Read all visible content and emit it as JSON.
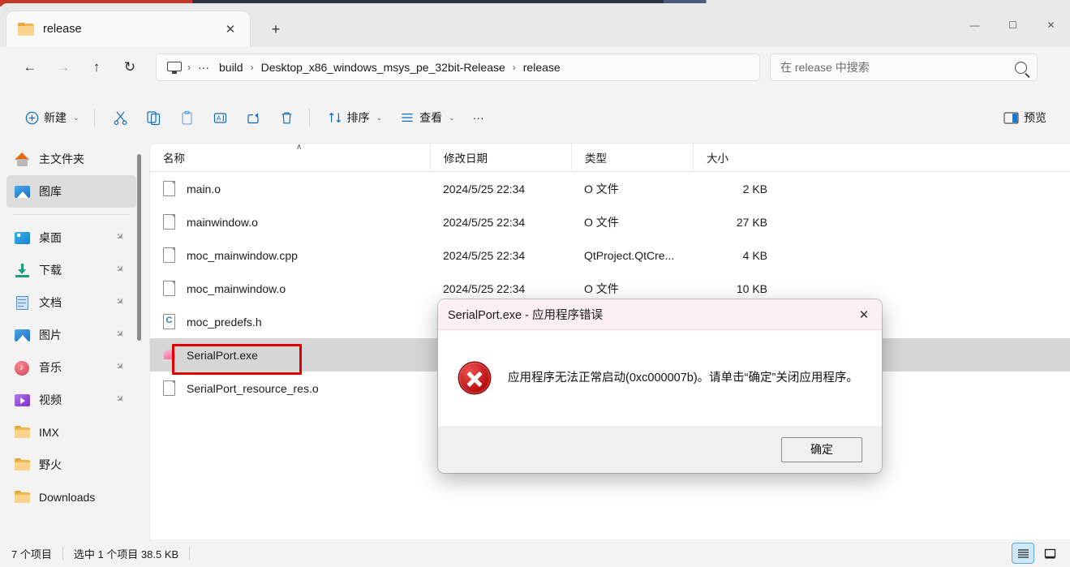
{
  "window": {
    "tab_title": "release",
    "tab_icon": "folder-icon",
    "close_tab_label": "✕",
    "new_tab_label": "+",
    "minimize_label": "—",
    "maximize_label": "☐",
    "close_label": "✕"
  },
  "nav": {
    "back_label": "←",
    "forward_label": "→",
    "up_label": "↑",
    "refresh_label": "↻",
    "breadcrumb": [
      "build",
      "Desktop_x86_windows_msys_pe_32bit-Release",
      "release"
    ],
    "breadcrumb_overflow": "···",
    "separator": "›"
  },
  "search": {
    "placeholder": "在 release 中搜索",
    "value": "",
    "icon": "search-icon"
  },
  "toolbar": {
    "new_label": "新建",
    "cut_label": "",
    "copy_label": "",
    "paste_label": "",
    "rename_label": "",
    "share_label": "",
    "delete_label": "",
    "sort_label": "排序",
    "view_label": "查看",
    "more_label": "···",
    "preview_label": "预览",
    "chevron": "⌄"
  },
  "sidebar": {
    "items": [
      {
        "label": "主文件夹",
        "icon": "home-icon",
        "selected": false,
        "pinned": false
      },
      {
        "label": "图库",
        "icon": "gallery-icon",
        "selected": true,
        "pinned": false
      },
      {
        "label": "桌面",
        "icon": "desktop-icon",
        "selected": false,
        "pinned": true
      },
      {
        "label": "下载",
        "icon": "download-icon",
        "selected": false,
        "pinned": true
      },
      {
        "label": "文档",
        "icon": "document-icon",
        "selected": false,
        "pinned": true
      },
      {
        "label": "图片",
        "icon": "pictures-icon",
        "selected": false,
        "pinned": true
      },
      {
        "label": "音乐",
        "icon": "music-icon",
        "selected": false,
        "pinned": true
      },
      {
        "label": "视频",
        "icon": "video-icon",
        "selected": false,
        "pinned": true
      },
      {
        "label": "IMX",
        "icon": "folder-icon",
        "selected": false,
        "pinned": false
      },
      {
        "label": "野火",
        "icon": "folder-icon",
        "selected": false,
        "pinned": false
      },
      {
        "label": "Downloads",
        "icon": "folder-icon",
        "selected": false,
        "pinned": false
      }
    ],
    "pin_glyph": "✈"
  },
  "filelist": {
    "columns": [
      {
        "label": "名称",
        "sorted": "asc"
      },
      {
        "label": "修改日期",
        "sorted": ""
      },
      {
        "label": "类型",
        "sorted": ""
      },
      {
        "label": "大小",
        "sorted": ""
      }
    ],
    "sort_arrow": "∧",
    "rows": [
      {
        "name": "main.o",
        "icon": "file-icon",
        "date": "2024/5/25 22:34",
        "type": "O 文件",
        "size": "2 KB",
        "selected": false
      },
      {
        "name": "mainwindow.o",
        "icon": "file-icon",
        "date": "2024/5/25 22:34",
        "type": "O 文件",
        "size": "27 KB",
        "selected": false
      },
      {
        "name": "moc_mainwindow.cpp",
        "icon": "file-icon",
        "date": "2024/5/25 22:34",
        "type": "QtProject.QtCre...",
        "size": "4 KB",
        "selected": false
      },
      {
        "name": "moc_mainwindow.o",
        "icon": "file-icon",
        "date": "2024/5/25 22:34",
        "type": "O 文件",
        "size": "10 KB",
        "selected": false
      },
      {
        "name": "moc_predefs.h",
        "icon": "c-header-icon",
        "date": "",
        "type": "",
        "size": "",
        "selected": false
      },
      {
        "name": "SerialPort.exe",
        "icon": "exe-icon",
        "date": "",
        "type": "",
        "size": "",
        "selected": true
      },
      {
        "name": "SerialPort_resource_res.o",
        "icon": "file-icon",
        "date": "",
        "type": "",
        "size": "",
        "selected": false
      }
    ]
  },
  "status": {
    "item_count": "7 个项目",
    "selection": "选中 1 个项目  38.5 KB",
    "view_details_label": "",
    "view_tiles_label": ""
  },
  "dialog": {
    "title": "SerialPort.exe - 应用程序错误",
    "close_label": "✕",
    "icon": "error-icon",
    "message": "应用程序无法正常启动(0xc000007b)。请单击“确定”关闭应用程序。",
    "ok_label": "确定"
  },
  "colors": {
    "accent": "#0f6cbd",
    "error_red": "#c00000",
    "annotation_red": "#e10000",
    "selection_gray": "#d6d6d6",
    "dialog_title_bg": "#fdf0f0"
  }
}
